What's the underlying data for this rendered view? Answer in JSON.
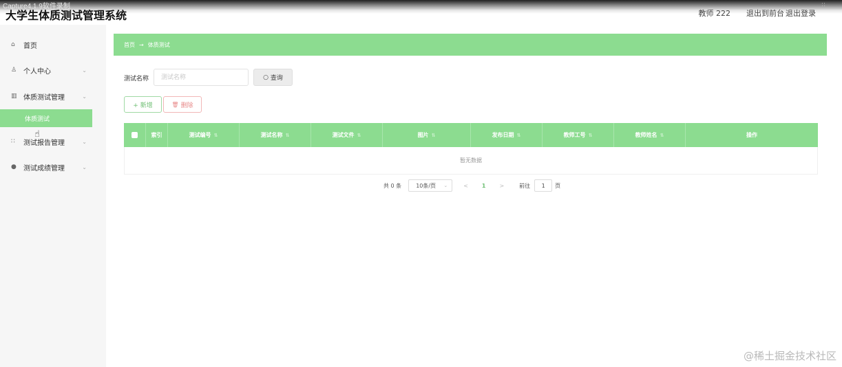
{
  "header": {
    "recorder_watermark": "Capture4.1.9软件录制",
    "title": "大学生体质测试管理系统",
    "user": "教师 222",
    "link_front": "退出到前台",
    "link_logout": "退出登录",
    "corner_mark": "::"
  },
  "sidebar": {
    "items": [
      {
        "label": "首页",
        "icon": "home-icon",
        "glyph": "⌂",
        "has_chevron": false
      },
      {
        "label": "个人中心",
        "icon": "user-icon",
        "glyph": "♙",
        "has_chevron": true
      },
      {
        "label": "体质测试管理",
        "icon": "chart-icon",
        "glyph": "▥",
        "has_chevron": true
      },
      {
        "label": "测试报告管理",
        "icon": "grid-icon",
        "glyph": "∷",
        "has_chevron": true
      },
      {
        "label": "测试成绩管理",
        "icon": "pin-icon",
        "glyph": "●",
        "has_chevron": true
      }
    ],
    "active_subitem": "体质测试",
    "chevron": "⌄"
  },
  "breadcrumb": {
    "home": "首页",
    "separator": "→",
    "current": "体质测试"
  },
  "search": {
    "label": "测试名称",
    "placeholder": "测试名称",
    "button": "查询",
    "button_icon": "○"
  },
  "actions": {
    "add": "+ 新增",
    "delete": "删除",
    "delete_icon": "🗑"
  },
  "table": {
    "columns": [
      "索引",
      "测试编号",
      "测试名称",
      "测试文件",
      "图片",
      "发布日期",
      "教师工号",
      "教师姓名",
      "操作"
    ],
    "sort_glyph": "⇅",
    "empty_text": "暂无数据"
  },
  "pagination": {
    "total": "共 0 条",
    "page_size": "10条/页",
    "prev": "<",
    "current_page": "1",
    "next": ">",
    "goto_label": "前往",
    "goto_value": "1",
    "page_unit": "页"
  },
  "watermark": "@稀土掘金技术社区",
  "colors": {
    "accent": "#8cdc90",
    "accent_text": "#6fbf74",
    "danger": "#e88a8a"
  }
}
